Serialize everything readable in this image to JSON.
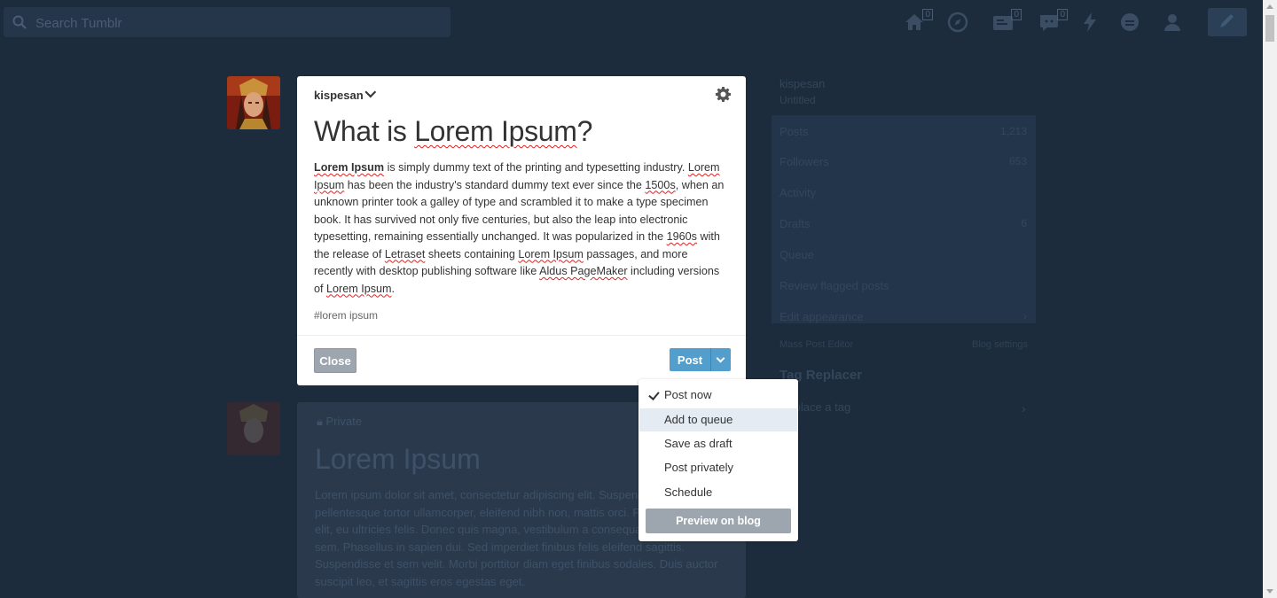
{
  "search": {
    "placeholder": "Search Tumblr"
  },
  "nav": {
    "home_badge": "0",
    "inbox_badge": "0",
    "messages_badge": "0"
  },
  "composer": {
    "blog_name": "kispesan",
    "title_plain": "What is ",
    "title_underlined": "Lorem Ipsum",
    "title_end": "?",
    "tags": "#lorem ipsum",
    "close_label": "Close",
    "post_label": "Post"
  },
  "post_menu": {
    "items": [
      "Post now",
      "Add to queue",
      "Save as draft",
      "Post privately",
      "Schedule"
    ],
    "selected": "Post now",
    "hovered": "Add to queue",
    "preview_label": "Preview on blog"
  },
  "background_post": {
    "status": "Private",
    "title": "Lorem Ipsum",
    "body": "Lorem ipsum dolor sit amet, consectetur adipiscing elit. Suspendisse pellentesque tortor ullamcorper, eleifend nibh non, mattis orci. Phasellus tincidunt elit, eu ultricies felis. Donec quis magna, vestibulum a consequat convallis at sem. Phasellus in sapien dui. Sed imperdiet finibus felis eleifend sagittis. Suspendisse et sem velit. Morbi porttitor diam eget finibus sodales. Duis auctor suscipit leo, et sagittis eros egestas eget."
  },
  "sidebar": {
    "blog_name": "kispesan",
    "blog_subtitle": "Untitled",
    "rows": [
      {
        "label": "Posts",
        "value": "1,213"
      },
      {
        "label": "Followers",
        "value": "653"
      },
      {
        "label": "Activity",
        "value": ""
      },
      {
        "label": "Drafts",
        "value": "6"
      },
      {
        "label": "Queue",
        "value": ""
      },
      {
        "label": "Review flagged posts",
        "value": ""
      },
      {
        "label": "Edit appearance",
        "value": ""
      }
    ],
    "tools_left": "Mass Post Editor",
    "tools_right": "Blog settings",
    "tag_section_title": "Tag Replacer",
    "tag_section_link": "Replace a tag"
  }
}
